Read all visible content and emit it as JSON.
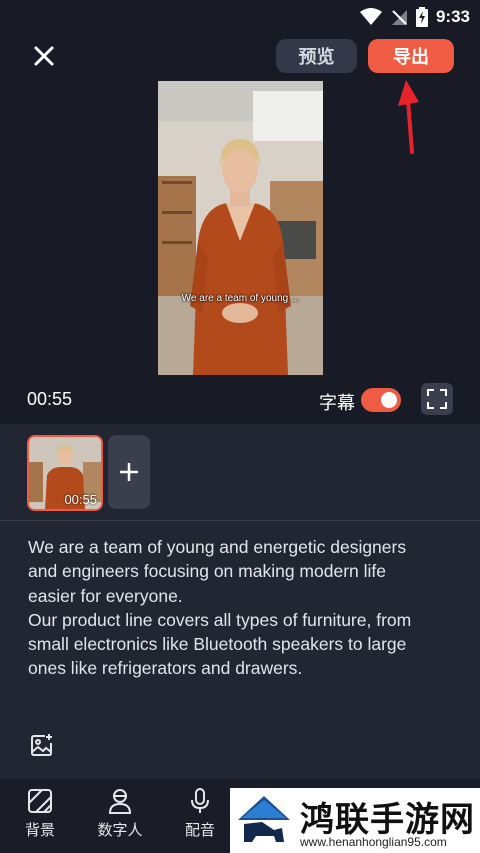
{
  "status_bar": {
    "time": "9:33",
    "icons": [
      "wifi-icon",
      "no-signal-icon",
      "battery-charging-icon"
    ]
  },
  "header": {
    "close_icon": "close-icon",
    "preview_label": "预览",
    "export_label": "导出"
  },
  "player": {
    "subtitle": "We are a team of young ...",
    "time": "00:55",
    "subtitle_label": "字幕",
    "subtitle_toggle_on": true,
    "fullscreen_icon": "fullscreen-icon"
  },
  "clips": {
    "items": [
      {
        "duration": "00:55"
      }
    ],
    "add_icon": "plus-icon"
  },
  "script": {
    "lines": [
      "We are a team of young and energetic designers",
      "and engineers focusing on making modern life",
      "easier for everyone.",
      "Our product line covers all types of furniture, from",
      "small electronics like Bluetooth speakers to large",
      "ones like refrigerators and drawers."
    ],
    "image_icon": "image-add-icon"
  },
  "bottom_nav": {
    "items": [
      {
        "label": "背景",
        "icon": "background-icon"
      },
      {
        "label": "数字人",
        "icon": "avatar-icon"
      },
      {
        "label": "配音",
        "icon": "microphone-icon"
      }
    ]
  },
  "watermark": {
    "title": "鸿联手游网",
    "url": "www.henanhonglian95.com"
  },
  "colors": {
    "accent": "#ef5b43",
    "background": "#1c1f2a",
    "panel": "#222633"
  }
}
